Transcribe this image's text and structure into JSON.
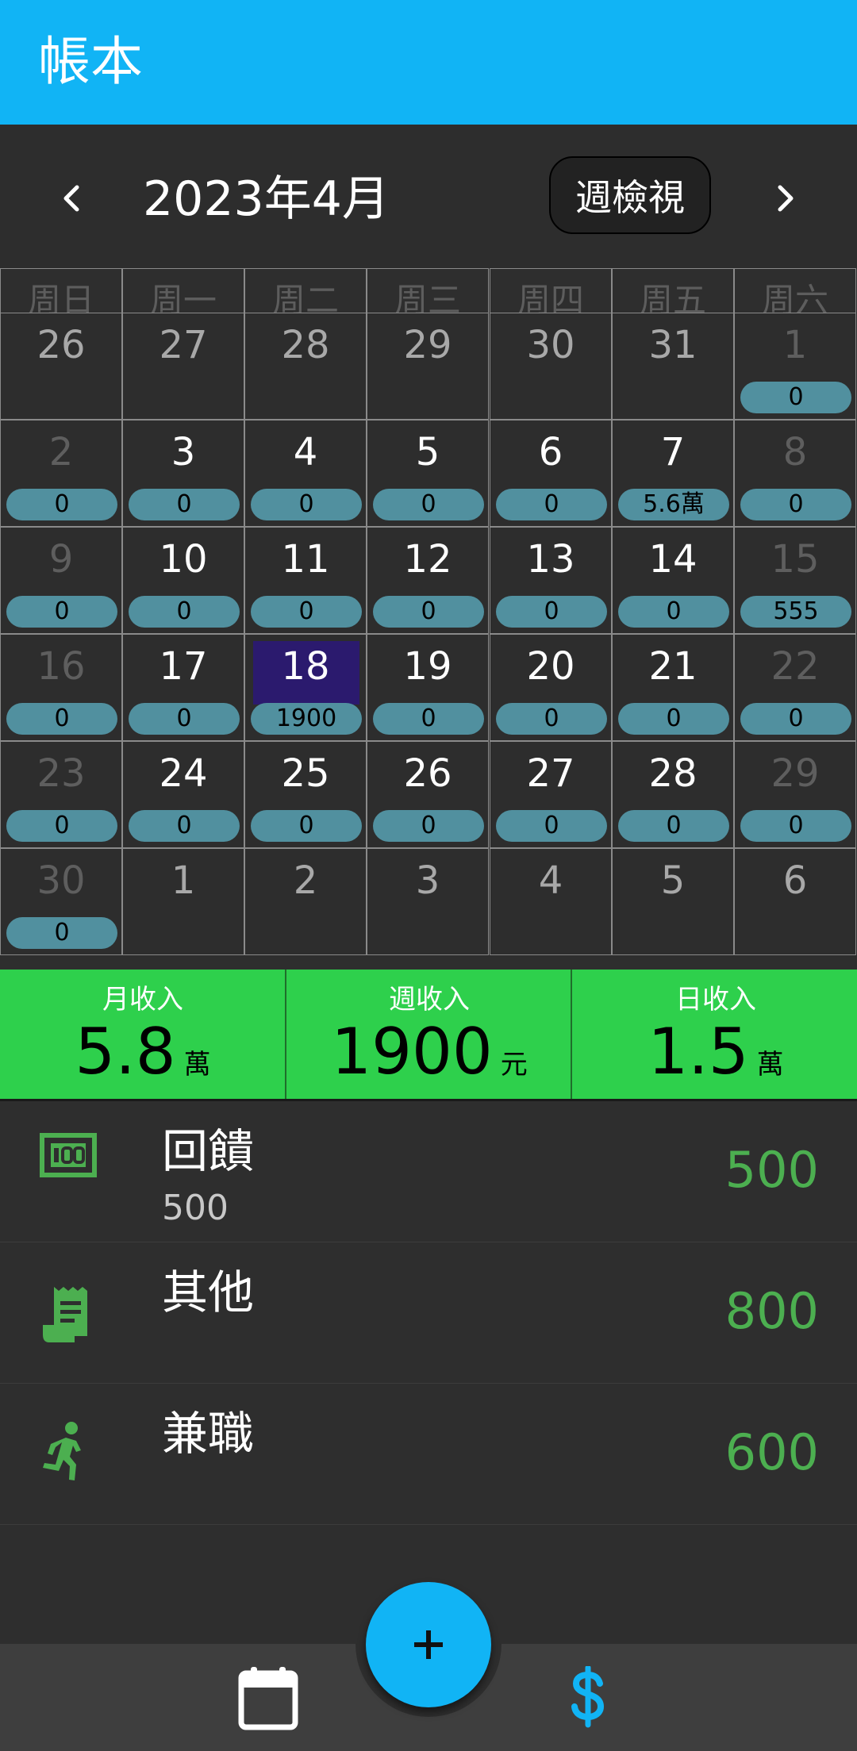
{
  "app": {
    "title": "帳本"
  },
  "month_bar": {
    "label": "2023年4月",
    "view_toggle": "週檢視"
  },
  "calendar": {
    "weekdays": [
      "周日",
      "周一",
      "周二",
      "周三",
      "周四",
      "周五",
      "周六"
    ],
    "weeks": [
      [
        {
          "d": "26",
          "t": "other",
          "v": null
        },
        {
          "d": "27",
          "t": "other",
          "v": null
        },
        {
          "d": "28",
          "t": "other",
          "v": null
        },
        {
          "d": "29",
          "t": "other",
          "v": null
        },
        {
          "d": "30",
          "t": "other",
          "v": null
        },
        {
          "d": "31",
          "t": "other",
          "v": null
        },
        {
          "d": "1",
          "t": "weekend",
          "v": "0"
        }
      ],
      [
        {
          "d": "2",
          "t": "weekend",
          "v": "0"
        },
        {
          "d": "3",
          "t": "cur",
          "v": "0"
        },
        {
          "d": "4",
          "t": "cur",
          "v": "0"
        },
        {
          "d": "5",
          "t": "cur",
          "v": "0"
        },
        {
          "d": "6",
          "t": "cur",
          "v": "0"
        },
        {
          "d": "7",
          "t": "cur",
          "v": "5.6萬"
        },
        {
          "d": "8",
          "t": "weekend",
          "v": "0"
        }
      ],
      [
        {
          "d": "9",
          "t": "weekend",
          "v": "0"
        },
        {
          "d": "10",
          "t": "cur",
          "v": "0"
        },
        {
          "d": "11",
          "t": "cur",
          "v": "0"
        },
        {
          "d": "12",
          "t": "cur",
          "v": "0"
        },
        {
          "d": "13",
          "t": "cur",
          "v": "0"
        },
        {
          "d": "14",
          "t": "cur",
          "v": "0"
        },
        {
          "d": "15",
          "t": "weekend",
          "v": "555"
        }
      ],
      [
        {
          "d": "16",
          "t": "weekend",
          "v": "0"
        },
        {
          "d": "17",
          "t": "cur",
          "v": "0"
        },
        {
          "d": "18",
          "t": "today",
          "v": "1900"
        },
        {
          "d": "19",
          "t": "cur",
          "v": "0"
        },
        {
          "d": "20",
          "t": "cur",
          "v": "0"
        },
        {
          "d": "21",
          "t": "cur",
          "v": "0"
        },
        {
          "d": "22",
          "t": "weekend",
          "v": "0"
        }
      ],
      [
        {
          "d": "23",
          "t": "weekend",
          "v": "0"
        },
        {
          "d": "24",
          "t": "cur",
          "v": "0"
        },
        {
          "d": "25",
          "t": "cur",
          "v": "0"
        },
        {
          "d": "26",
          "t": "cur",
          "v": "0"
        },
        {
          "d": "27",
          "t": "cur",
          "v": "0"
        },
        {
          "d": "28",
          "t": "cur",
          "v": "0"
        },
        {
          "d": "29",
          "t": "weekend",
          "v": "0"
        }
      ],
      [
        {
          "d": "30",
          "t": "weekend",
          "v": "0"
        },
        {
          "d": "1",
          "t": "other",
          "v": null
        },
        {
          "d": "2",
          "t": "other",
          "v": null
        },
        {
          "d": "3",
          "t": "other",
          "v": null
        },
        {
          "d": "4",
          "t": "other",
          "v": null
        },
        {
          "d": "5",
          "t": "other",
          "v": null
        },
        {
          "d": "6",
          "t": "other",
          "v": null
        }
      ]
    ]
  },
  "summary": [
    {
      "label": "月收入",
      "value": "5.8",
      "unit": "萬"
    },
    {
      "label": "週收入",
      "value": "1900",
      "unit": "元"
    },
    {
      "label": "日收入",
      "value": "1.5",
      "unit": "萬"
    }
  ],
  "entries": [
    {
      "icon": "money-bill-icon",
      "title": "回饋",
      "subtitle": "500",
      "amount": "500"
    },
    {
      "icon": "receipt-icon",
      "title": "其他",
      "subtitle": "",
      "amount": "800"
    },
    {
      "icon": "running-person-icon",
      "title": "兼職",
      "subtitle": "",
      "amount": "600"
    }
  ],
  "bottom_nav": {
    "fab_icon": "plus-icon",
    "left_icon": "calendar-icon",
    "right_icon": "dollar-icon"
  },
  "colors": {
    "app_bar": "#11b4f5",
    "summary_bg": "#2ed04c",
    "pill": "#51909f",
    "today_highlight": "#2b1a6e",
    "amount": "#4caf50",
    "fab": "#11b4f5"
  }
}
